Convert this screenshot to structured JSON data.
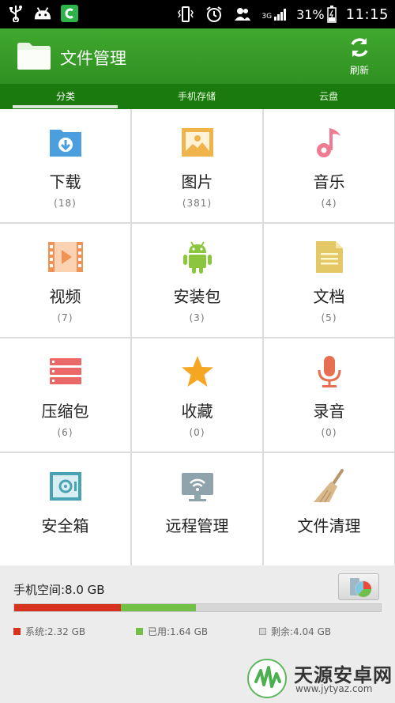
{
  "statusbar": {
    "battery_percent": "31%",
    "network": "3G",
    "time": "11:15"
  },
  "appbar": {
    "title": "文件管理",
    "refresh_label": "刷新"
  },
  "tabs": [
    {
      "label": "分类",
      "active": true
    },
    {
      "label": "手机存储",
      "active": false
    },
    {
      "label": "云盘",
      "active": false
    }
  ],
  "categories": [
    {
      "name": "下载",
      "count": "(18)",
      "icon": "download-folder-icon"
    },
    {
      "name": "图片",
      "count": "(381)",
      "icon": "image-icon"
    },
    {
      "name": "音乐",
      "count": "(4)",
      "icon": "music-note-icon"
    },
    {
      "name": "视频",
      "count": "(7)",
      "icon": "video-icon"
    },
    {
      "name": "安装包",
      "count": "(3)",
      "icon": "android-icon"
    },
    {
      "name": "文档",
      "count": "(5)",
      "icon": "document-icon"
    },
    {
      "name": "压缩包",
      "count": "(6)",
      "icon": "archive-icon"
    },
    {
      "name": "收藏",
      "count": "(0)",
      "icon": "star-icon"
    },
    {
      "name": "录音",
      "count": "(0)",
      "icon": "microphone-icon"
    },
    {
      "name": "安全箱",
      "icon": "safe-icon"
    },
    {
      "name": "远程管理",
      "icon": "remote-monitor-icon"
    },
    {
      "name": "文件清理",
      "icon": "broom-icon"
    }
  ],
  "storage": {
    "label": "手机空间:8.0 GB",
    "total_gb": 8.0,
    "system": {
      "label": "系统:2.32 GB",
      "gb": 2.32,
      "color": "#d6321d"
    },
    "used": {
      "label": "已用:1.64 GB",
      "gb": 1.64,
      "color": "#72c046"
    },
    "free": {
      "label": "剩余:4.04 GB",
      "gb": 4.04,
      "color": "#d6d6d6"
    }
  },
  "watermark": {
    "title": "天源安卓网",
    "url": "www.jytyaz.com"
  },
  "colors": {
    "appbar": "#40a82f",
    "tabbar": "#1b7a0d"
  }
}
